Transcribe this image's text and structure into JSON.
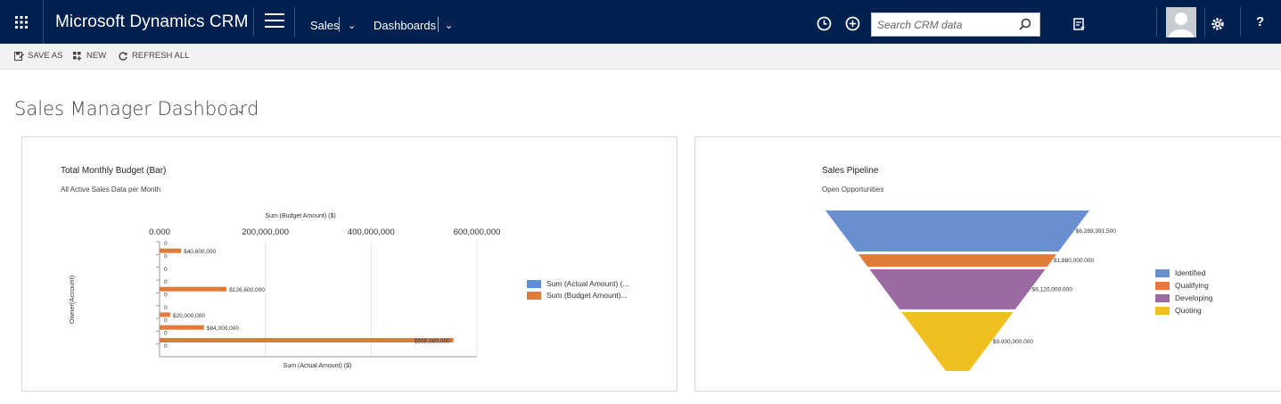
{
  "header": {
    "app_title": "Microsoft Dynamics CRM",
    "nav": [
      {
        "label": "Sales"
      },
      {
        "label": "Dashboards"
      }
    ],
    "search_placeholder": "Search CRM data",
    "help_label": "?",
    "colors": {
      "bar_bg": "#002050"
    }
  },
  "commands": [
    {
      "label": "SAVE AS",
      "icon": "save-as-icon"
    },
    {
      "label": "NEW",
      "icon": "new-icon"
    },
    {
      "label": "REFRESH ALL",
      "icon": "refresh-icon"
    }
  ],
  "dashboard": {
    "title": "Sales Manager Dashboard"
  },
  "chart_data": [
    {
      "type": "bar",
      "orientation": "horizontal",
      "title": "Total Monthly Budget (Bar)",
      "subtitle": "All Active Sales Data per Month",
      "top_axis_label": "Sum (Budget Amount) ($)",
      "xlabel": "Sum (Actual Amount) ($)",
      "ylabel": "Owner(Account)",
      "ticks": [
        "0.000",
        "200,000,000",
        "400,000,000",
        "600,000,000"
      ],
      "xlim": [
        0,
        600000000
      ],
      "categories": [
        "",
        "",
        "",
        "",
        "",
        "",
        "",
        "",
        ""
      ],
      "series": [
        {
          "name": "Sum (Actual Amount) (...",
          "color": "#5b8fd6",
          "values": [
            0,
            0,
            0,
            0,
            0,
            0,
            0,
            0,
            0
          ],
          "labels": [
            "0",
            "0",
            "0",
            "0",
            "0",
            "0",
            "0",
            "0",
            "0"
          ]
        },
        {
          "name": "Sum (Budget Amount)...",
          "color": "#e27a39",
          "values": [
            40600000,
            0,
            0,
            126600000,
            0,
            20000000,
            84000000,
            555680000,
            0
          ],
          "labels": [
            "$40,600,000",
            "",
            "",
            "$126,600,000",
            "",
            "$20,000,000",
            "$84,000,000",
            "$555,680,000",
            ""
          ]
        }
      ],
      "legend": "right"
    },
    {
      "type": "funnel",
      "title": "Sales Pipeline",
      "subtitle": "Open Opportunities",
      "categories": [
        "Identified",
        "Qualifying",
        "Developing",
        "Quoting"
      ],
      "values": [
        6289391.5,
        1880000,
        6120000,
        9000000
      ],
      "labels": [
        "$6,289,391.500",
        "$1,880,000.000",
        "$6,120,000.000",
        "$9,000,000.000"
      ],
      "colors": [
        "#6a8fd0",
        "#e07b39",
        "#9a6aa3",
        "#f0c020"
      ],
      "legend": "right"
    }
  ]
}
